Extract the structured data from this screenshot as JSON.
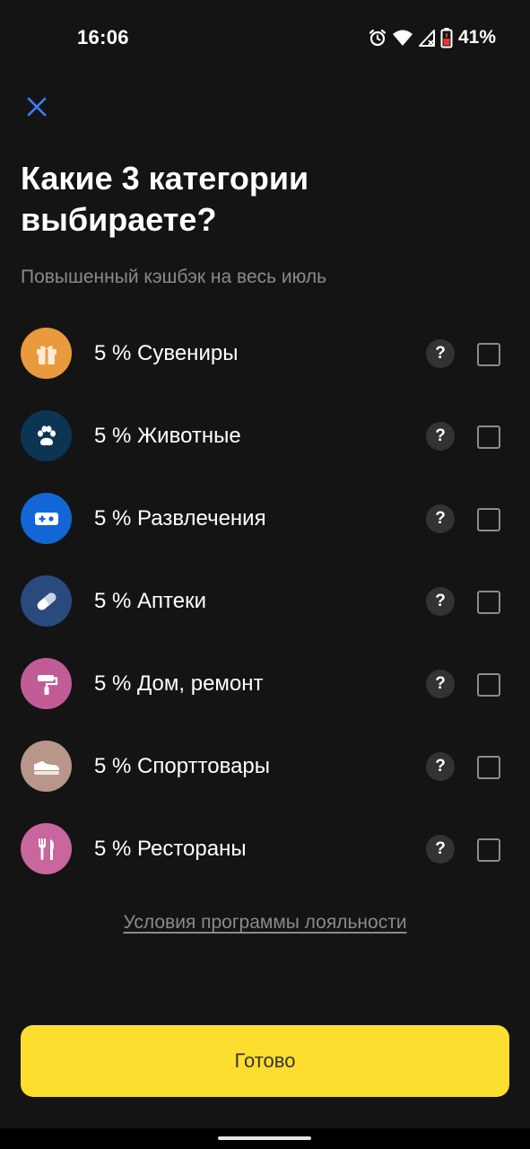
{
  "status_bar": {
    "time": "16:06",
    "battery_percent": "41%",
    "icons": [
      "alarm-icon",
      "wifi-icon",
      "signal-icon",
      "battery-icon"
    ]
  },
  "header": {
    "close_icon": "close-icon",
    "title": "Какие 3 категории выбираете?",
    "subtitle": "Повышенный кэшбэк на весь июль"
  },
  "categories": [
    {
      "label": "5 % Сувениры",
      "icon": "gift-icon",
      "color": "#E89A3C",
      "help": "?",
      "checked": false
    },
    {
      "label": "5 % Животные",
      "icon": "paw-icon",
      "color": "#0B3552",
      "help": "?",
      "checked": false
    },
    {
      "label": "5 % Развлечения",
      "icon": "ticket-icon",
      "color": "#1366D6",
      "help": "?",
      "checked": false
    },
    {
      "label": "5 % Аптеки",
      "icon": "pill-icon",
      "color": "#2A4A7E",
      "help": "?",
      "checked": false
    },
    {
      "label": "5 % Дом, ремонт",
      "icon": "paint-roller-icon",
      "color": "#C25C97",
      "help": "?",
      "checked": false
    },
    {
      "label": "5 % Спорттовары",
      "icon": "sneaker-icon",
      "color": "#B8968A",
      "help": "?",
      "checked": false
    },
    {
      "label": "5 % Рестораны",
      "icon": "cutlery-icon",
      "color": "#C8679E",
      "help": "?",
      "checked": false
    }
  ],
  "terms_link": "Условия программы лояльности",
  "done_button": "Готово",
  "colors": {
    "background": "#141414",
    "accent_yellow": "#FDDD2E",
    "close_blue": "#3D7EF7",
    "muted_text": "#8A8A8A"
  }
}
